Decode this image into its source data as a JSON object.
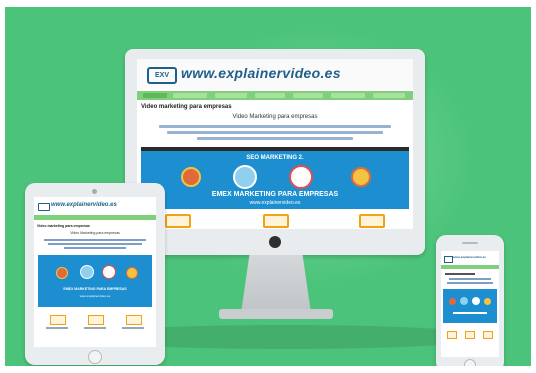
{
  "site": {
    "logo_badge": "EXV",
    "logo_text": "www.explainervideo.es",
    "page_heading": "Video marketing para empresas",
    "page_subtitle": "Video Marketing para empresas",
    "banner_title": "SEO MARKETING 2.",
    "banner_main": "EMEX MARKETING PARA EMPRESAS",
    "banner_url": "www.explainervideo.es"
  },
  "tablet": {
    "logo_text": "www.explainervideo.es",
    "heading": "Video marketing para empresas",
    "subtitle": "Video Marketing para empresas",
    "banner_main": "EMEX MARKETING PARA EMPRESAS",
    "banner_url": "www.explainervideo.es"
  },
  "phone": {
    "logo_text": "www.explainervideo.es"
  },
  "colors": {
    "background": "#4cc37a",
    "brand_blue": "#1f5f8b",
    "nav_green": "#7fcf7c",
    "banner_blue": "#1d8fd1",
    "accent_orange": "#f2a21a"
  }
}
